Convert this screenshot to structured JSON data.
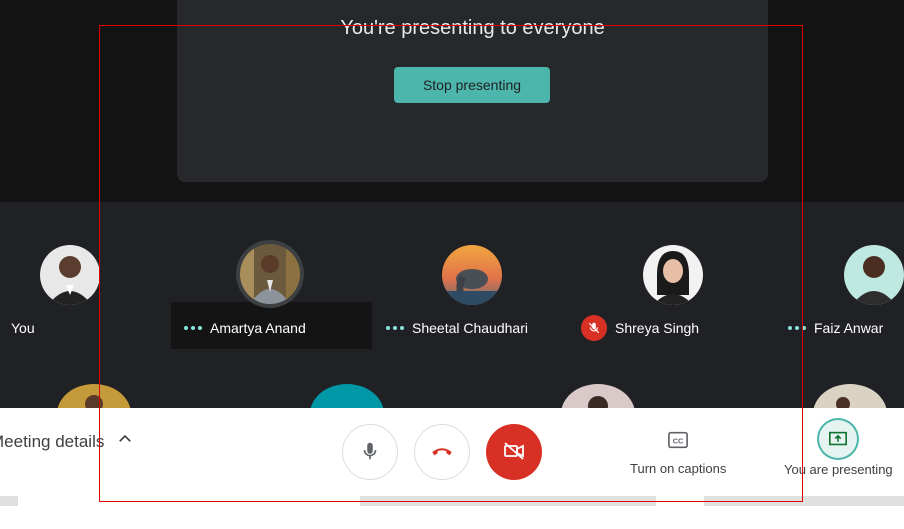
{
  "presentation": {
    "title": "You're presenting to everyone",
    "stop_button": "Stop presenting"
  },
  "participants": [
    {
      "name": "You",
      "speaking": false,
      "muted": false
    },
    {
      "name": "Amartya Anand",
      "speaking": true,
      "muted": false
    },
    {
      "name": "Sheetal Chaudhari",
      "speaking": true,
      "muted": false
    },
    {
      "name": "Shreya Singh",
      "speaking": false,
      "muted": true
    },
    {
      "name": "Faiz Anwar",
      "speaking": true,
      "muted": false
    }
  ],
  "toolbar": {
    "meeting_details": "Meeting details",
    "captions_label": "Turn on captions",
    "presenting_label": "You are presenting"
  },
  "colors": {
    "accent": "#4db6ac",
    "danger": "#d93025",
    "frame": "#e00000"
  },
  "icons": {
    "mic": "mic-icon",
    "hangup": "phone-hangup-icon",
    "camera_off": "camera-off-icon",
    "captions": "cc-icon",
    "present": "present-screen-icon",
    "chevron": "chevron-up-icon"
  }
}
